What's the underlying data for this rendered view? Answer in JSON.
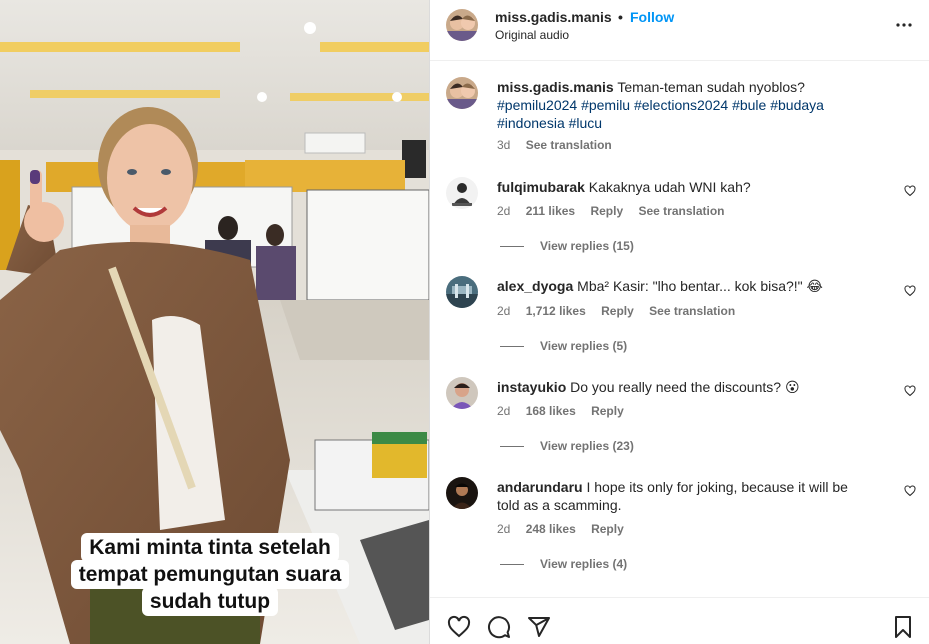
{
  "video": {
    "caption_lines": [
      "Kami minta tinta setelah",
      "tempat pemungutan suara",
      "sudah tutup"
    ]
  },
  "post": {
    "username": "miss.gadis.manis",
    "separator": "•",
    "follow_label": "Follow",
    "audio_label": "Original audio",
    "more_icon": "more-horizontal-icon"
  },
  "caption_entry": {
    "username": "miss.gadis.manis",
    "text": "Teman-teman sudah nyoblos?",
    "hashtags": [
      "#pemilu2024",
      "#pemilu",
      "#elections2024",
      "#bule",
      "#budaya",
      "#indonesia",
      "#lucu"
    ],
    "time": "3d",
    "see_translation": "See translation"
  },
  "comments": [
    {
      "username": "fulqimubarak",
      "text": "Kakaknya udah WNI kah?",
      "time": "2d",
      "likes": "211 likes",
      "reply": "Reply",
      "see_translation": "See translation",
      "view_replies": "View replies (15)"
    },
    {
      "username": "alex_dyoga",
      "text": "Mba² Kasir: \"lho bentar... kok bisa?!\" 😂",
      "time": "2d",
      "likes": "1,712 likes",
      "reply": "Reply",
      "see_translation": "See translation",
      "view_replies": "View replies (5)"
    },
    {
      "username": "instayukio",
      "text": "Do you really need the discounts? 😮",
      "time": "2d",
      "likes": "168 likes",
      "reply": "Reply",
      "view_replies": "View replies (23)"
    },
    {
      "username": "andarundaru",
      "text": "I hope its only for joking, because it will be told as a scamming.",
      "time": "2d",
      "likes": "248 likes",
      "reply": "Reply",
      "view_replies": "View replies (4)"
    }
  ],
  "actions": [
    "heart-icon",
    "comment-icon",
    "share-icon",
    "bookmark-icon"
  ],
  "colors": {
    "accent": "#0095f6",
    "hashtag": "#00376b",
    "meta": "#737373",
    "text": "#262626"
  }
}
